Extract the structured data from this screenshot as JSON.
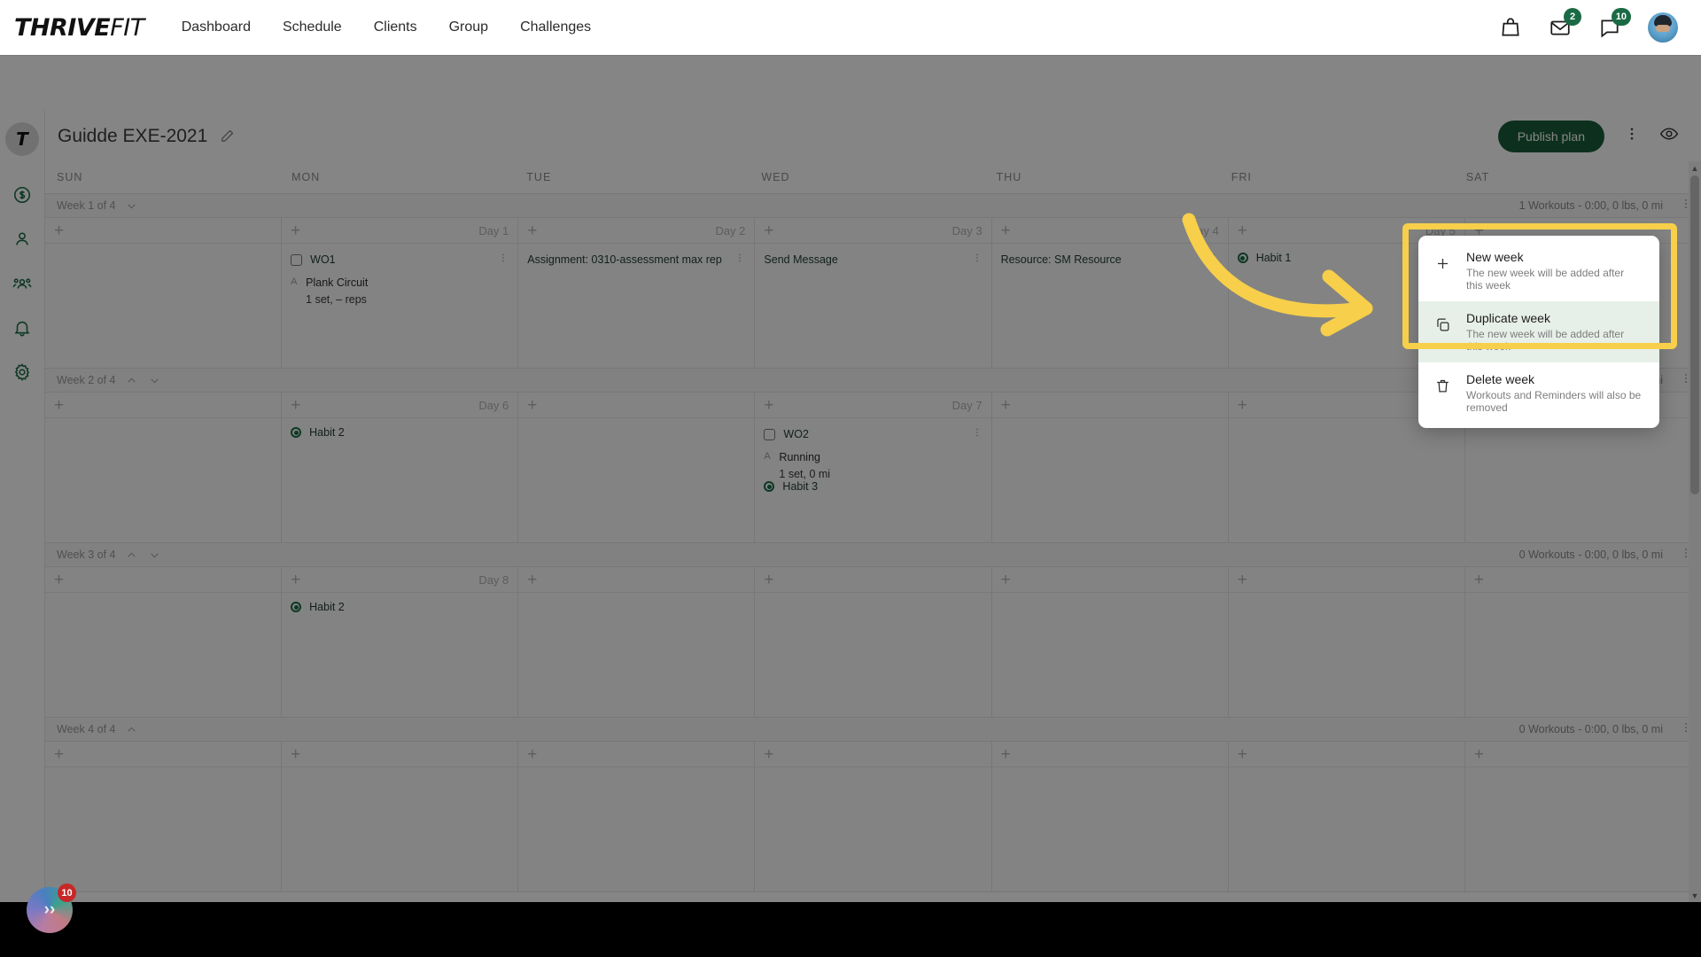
{
  "brand": {
    "bold": "THRIVE",
    "light": "FIT"
  },
  "topnav": {
    "links": [
      "Dashboard",
      "Schedule",
      "Clients",
      "Group",
      "Challenges"
    ],
    "icons": [
      {
        "name": "bag-icon",
        "badge": null
      },
      {
        "name": "mail-icon",
        "badge": "2"
      },
      {
        "name": "chat-icon",
        "badge": "10"
      }
    ],
    "avatar_name": "user-avatar"
  },
  "rail": {
    "logo_text": "T",
    "items": [
      {
        "name": "billing-icon",
        "label": "Billing"
      },
      {
        "name": "person-icon",
        "label": "Clients"
      },
      {
        "name": "group-icon",
        "label": "Groups"
      },
      {
        "name": "bell-icon",
        "label": "Notifications"
      },
      {
        "name": "gear-icon",
        "label": "Settings"
      }
    ]
  },
  "pagehead": {
    "plan_title": "Guidde EXE-2021",
    "publish_label": "Publish plan"
  },
  "calendar": {
    "day_headers": [
      "SUN",
      "MON",
      "TUE",
      "WED",
      "THU",
      "FRI",
      "SAT"
    ],
    "weeks": [
      {
        "label": "Week 1 of 4",
        "summary": "1 Workouts - 0:00, 0 lbs, 0 mi",
        "chevrons": [
          "down"
        ],
        "days": [
          {
            "day_label": "",
            "items": []
          },
          {
            "day_label": "Day 1",
            "items": [
              {
                "type": "workout",
                "label": "WO1",
                "exercises": [
                  {
                    "tag": "A",
                    "name": "Plank Circuit",
                    "sets": "1 set, – reps"
                  }
                ]
              }
            ]
          },
          {
            "day_label": "Day 2",
            "items": [
              {
                "type": "task",
                "label": "Assignment: 0310-assessment max rep"
              }
            ]
          },
          {
            "day_label": "Day 3",
            "items": [
              {
                "type": "task",
                "label": "Send Message"
              }
            ]
          },
          {
            "day_label": "Day 4",
            "items": [
              {
                "type": "task",
                "label": "Resource: SM Resource"
              }
            ]
          },
          {
            "day_label": "Day 5",
            "items": [
              {
                "type": "habit",
                "label": "Habit 1"
              }
            ]
          },
          {
            "day_label": "",
            "items": []
          }
        ]
      },
      {
        "label": "Week 2 of 4",
        "summary": "1 Workouts - 0:00, 0 lbs, 0 mi",
        "chevrons": [
          "up",
          "down"
        ],
        "days": [
          {
            "day_label": "",
            "items": []
          },
          {
            "day_label": "Day 6",
            "items": [
              {
                "type": "habit",
                "label": "Habit 2"
              }
            ]
          },
          {
            "day_label": "",
            "items": []
          },
          {
            "day_label": "Day 7",
            "items": [
              {
                "type": "workout",
                "label": "WO2",
                "exercises": [
                  {
                    "tag": "A",
                    "name": "Running",
                    "sets": "1 set, 0 mi"
                  }
                ]
              },
              {
                "type": "habit",
                "label": "Habit 3"
              }
            ]
          },
          {
            "day_label": "",
            "items": []
          },
          {
            "day_label": "",
            "items": []
          },
          {
            "day_label": "",
            "items": []
          }
        ]
      },
      {
        "label": "Week 3 of 4",
        "summary": "0 Workouts - 0:00, 0 lbs, 0 mi",
        "chevrons": [
          "up",
          "down"
        ],
        "days": [
          {
            "day_label": "",
            "items": []
          },
          {
            "day_label": "Day 8",
            "items": [
              {
                "type": "habit",
                "label": "Habit 2"
              }
            ]
          },
          {
            "day_label": "",
            "items": []
          },
          {
            "day_label": "",
            "items": []
          },
          {
            "day_label": "",
            "items": []
          },
          {
            "day_label": "",
            "items": []
          },
          {
            "day_label": "",
            "items": []
          }
        ]
      },
      {
        "label": "Week 4 of 4",
        "summary": "0 Workouts - 0:00, 0 lbs, 0 mi",
        "chevrons": [
          "up"
        ],
        "days": [
          {
            "day_label": "",
            "items": []
          },
          {
            "day_label": "",
            "items": []
          },
          {
            "day_label": "",
            "items": []
          },
          {
            "day_label": "",
            "items": []
          },
          {
            "day_label": "",
            "items": []
          },
          {
            "day_label": "",
            "items": []
          },
          {
            "day_label": "",
            "items": []
          }
        ]
      }
    ]
  },
  "context_menu": {
    "items": [
      {
        "icon": "plus-icon",
        "title": "New week",
        "subtitle": "The new week will be added after this week",
        "active": false
      },
      {
        "icon": "duplicate-icon",
        "title": "Duplicate week",
        "subtitle": "The new week will be added after this week",
        "active": true
      },
      {
        "icon": "trash-icon",
        "title": "Delete week",
        "subtitle": "Workouts and Reminders will also be removed",
        "active": false
      }
    ]
  },
  "float_widget": {
    "badge": "10",
    "glyph": "››"
  },
  "colors": {
    "brand_green": "#1a5c3a",
    "accent_green": "#1a6b45",
    "highlight_yellow": "#f7cf4a",
    "badge_red": "#c62828"
  }
}
